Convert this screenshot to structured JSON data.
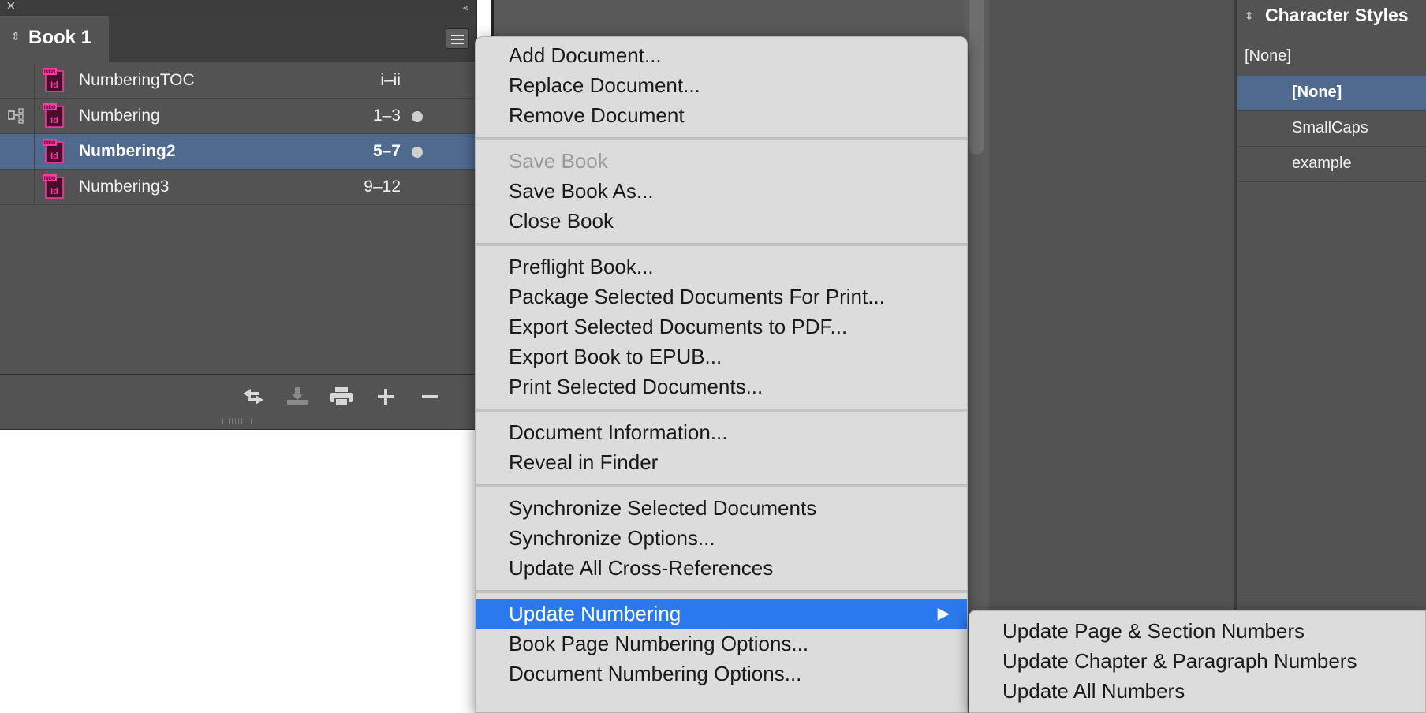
{
  "book_panel": {
    "title": "Book 1",
    "documents": [
      {
        "name": "NumberingTOC",
        "pages": "i–ii",
        "synced": false,
        "dot": false,
        "selected": false
      },
      {
        "name": "Numbering",
        "pages": "1–3",
        "synced": true,
        "dot": true,
        "selected": false
      },
      {
        "name": "Numbering2",
        "pages": "5–7",
        "synced": false,
        "dot": true,
        "selected": true
      },
      {
        "name": "Numbering3",
        "pages": "9–12",
        "synced": false,
        "dot": false,
        "selected": false
      }
    ],
    "icon_badge_top": "INDD",
    "icon_badge_main": "Id"
  },
  "context_menu": {
    "groups": [
      [
        {
          "label": "Add Document..."
        },
        {
          "label": "Replace Document..."
        },
        {
          "label": "Remove Document"
        }
      ],
      [
        {
          "label": "Save Book",
          "disabled": true
        },
        {
          "label": "Save Book As..."
        },
        {
          "label": "Close Book"
        }
      ],
      [
        {
          "label": "Preflight Book..."
        },
        {
          "label": "Package Selected Documents For Print..."
        },
        {
          "label": "Export Selected Documents to PDF..."
        },
        {
          "label": "Export Book to EPUB..."
        },
        {
          "label": "Print Selected Documents..."
        }
      ],
      [
        {
          "label": "Document Information..."
        },
        {
          "label": "Reveal in Finder"
        }
      ],
      [
        {
          "label": "Synchronize Selected Documents"
        },
        {
          "label": "Synchronize Options..."
        },
        {
          "label": "Update All Cross-References"
        }
      ],
      [
        {
          "label": "Update Numbering",
          "highlight": true,
          "submenu": true
        },
        {
          "label": "Book Page Numbering Options..."
        },
        {
          "label": "Document Numbering Options..."
        }
      ]
    ]
  },
  "submenu": {
    "items": [
      {
        "label": "Update Page & Section Numbers"
      },
      {
        "label": "Update Chapter & Paragraph Numbers"
      },
      {
        "label": "Update All Numbers"
      }
    ]
  },
  "character_styles": {
    "title": "Character Styles",
    "current": "[None]",
    "items": [
      {
        "label": "[None]",
        "selected": true
      },
      {
        "label": "SmallCaps",
        "selected": false
      },
      {
        "label": "example",
        "selected": false
      }
    ]
  },
  "colors": {
    "highlight": "#2b79ec",
    "selection": "#4f6a8d",
    "indesign_pink": "#ff3aa6",
    "panel_bg": "#535353"
  }
}
